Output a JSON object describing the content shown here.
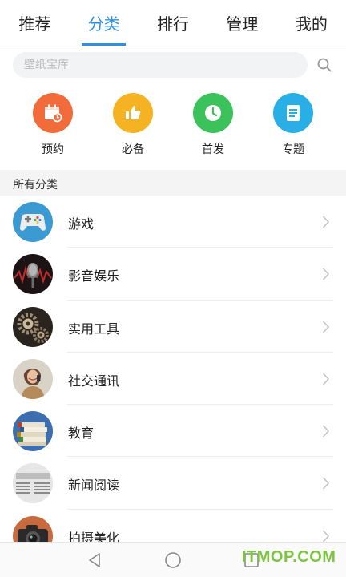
{
  "tabs": [
    {
      "label": "推荐"
    },
    {
      "label": "分类",
      "active": true
    },
    {
      "label": "排行"
    },
    {
      "label": "管理"
    },
    {
      "label": "我的"
    }
  ],
  "search": {
    "placeholder": "壁纸宝库"
  },
  "quick_entries": [
    {
      "label": "预约",
      "icon": "calendar-clock-icon",
      "color": "#f26b3a"
    },
    {
      "label": "必备",
      "icon": "thumbs-up-icon",
      "color": "#f5b324"
    },
    {
      "label": "首发",
      "icon": "clock-icon",
      "color": "#3cc25a"
    },
    {
      "label": "专题",
      "icon": "document-icon",
      "color": "#2aaee6"
    }
  ],
  "section": {
    "title": "所有分类"
  },
  "categories": [
    {
      "label": "游戏",
      "icon": "gamepad-icon"
    },
    {
      "label": "影音娱乐",
      "icon": "microphone-icon"
    },
    {
      "label": "实用工具",
      "icon": "gears-icon"
    },
    {
      "label": "社交通讯",
      "icon": "person-phone-icon"
    },
    {
      "label": "教育",
      "icon": "books-icon"
    },
    {
      "label": "新闻阅读",
      "icon": "newspaper-icon"
    },
    {
      "label": "拍摄美化",
      "icon": "camera-icon"
    }
  ],
  "accent_color": "#2f8fe0",
  "watermark": "ITMOP.COM"
}
